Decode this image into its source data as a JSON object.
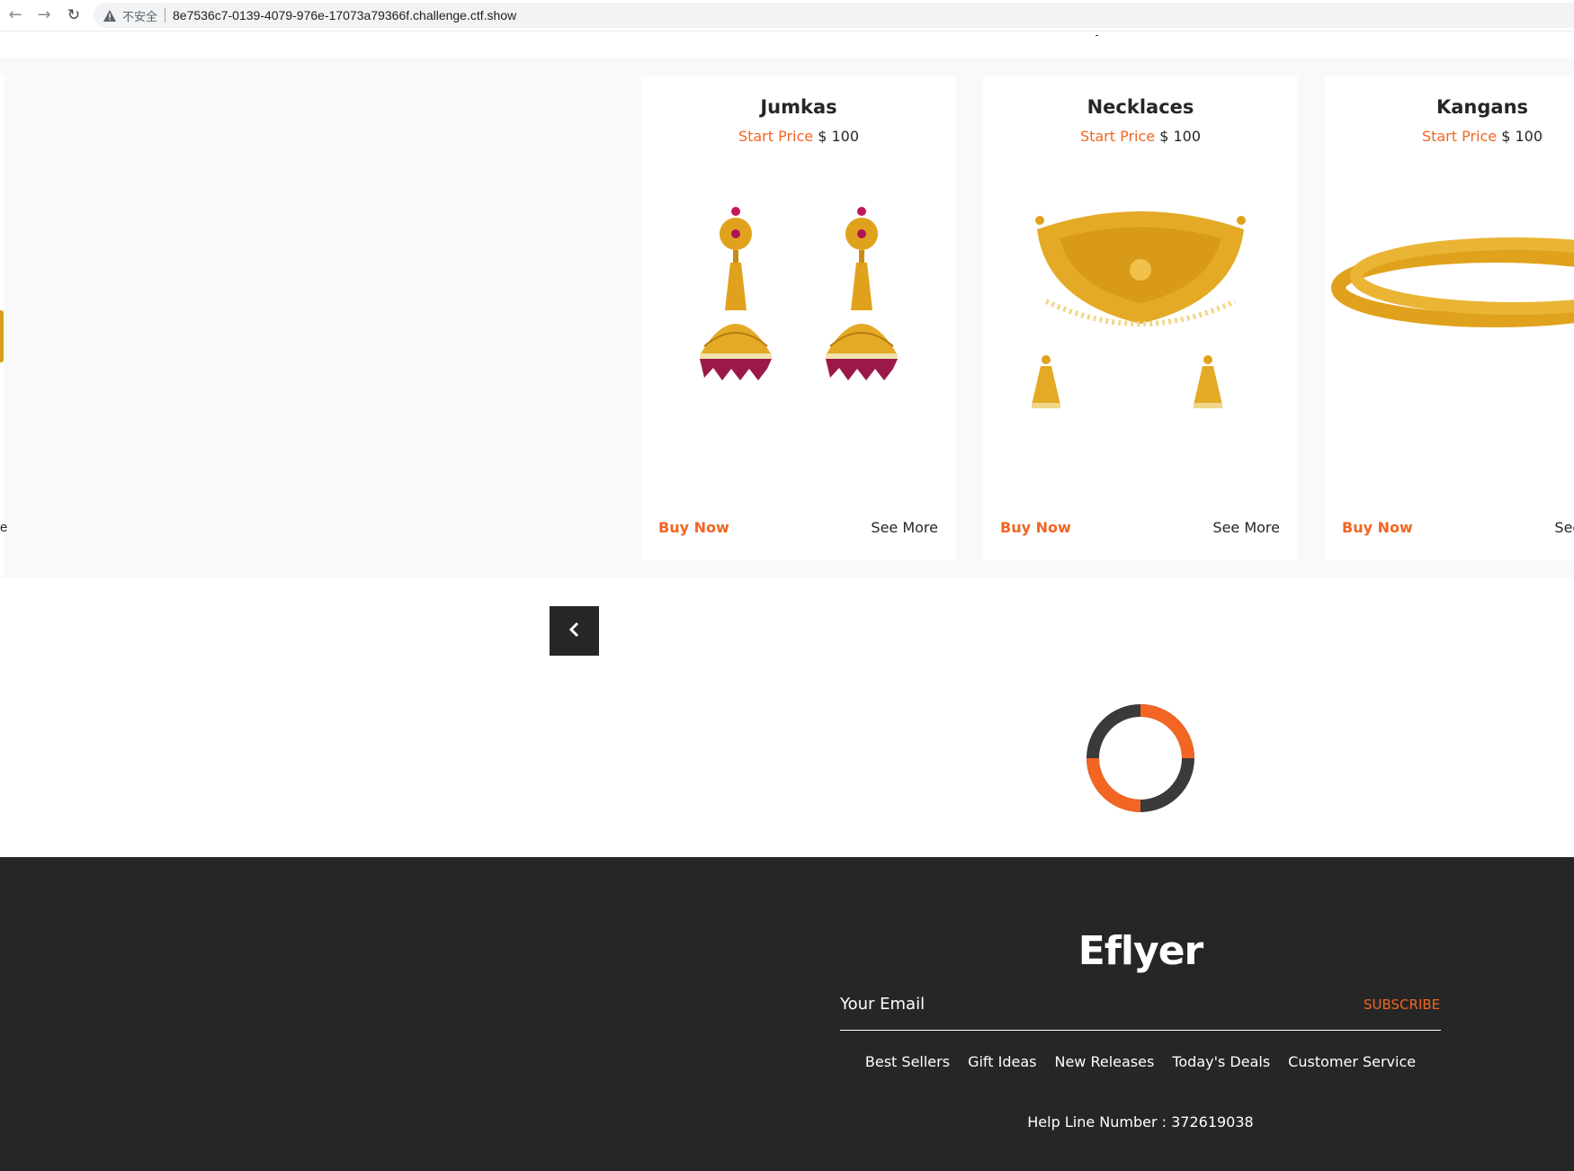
{
  "browser": {
    "security_label": "不安全",
    "url": "8e7536c7-0139-4079-976e-17073a79366f.challenge.ctf.show"
  },
  "products": [
    {
      "title": "Jumkas",
      "price_label": "Start Price",
      "price_value": "$ 100",
      "buy_label": "Buy Now",
      "more_label": "See More"
    },
    {
      "title": "Necklaces",
      "price_label": "Start Price",
      "price_value": "$ 100",
      "buy_label": "Buy Now",
      "more_label": "See More"
    },
    {
      "title": "Kangans",
      "price_label": "Start Price",
      "price_value": "$ 100",
      "buy_label": "Buy Now",
      "more_label": "See More"
    }
  ],
  "edge_text": "e",
  "footer": {
    "logo": "Eflyer",
    "email_placeholder": "Your Email",
    "subscribe_label": "SUBSCRIBE",
    "links": [
      "Best Sellers",
      "Gift Ideas",
      "New Releases",
      "Today's Deals",
      "Customer Service"
    ],
    "helpline": "Help Line Number : 372619038"
  },
  "colors": {
    "accent": "#f26522",
    "dark": "#262626",
    "gold": "#e0a21c"
  }
}
